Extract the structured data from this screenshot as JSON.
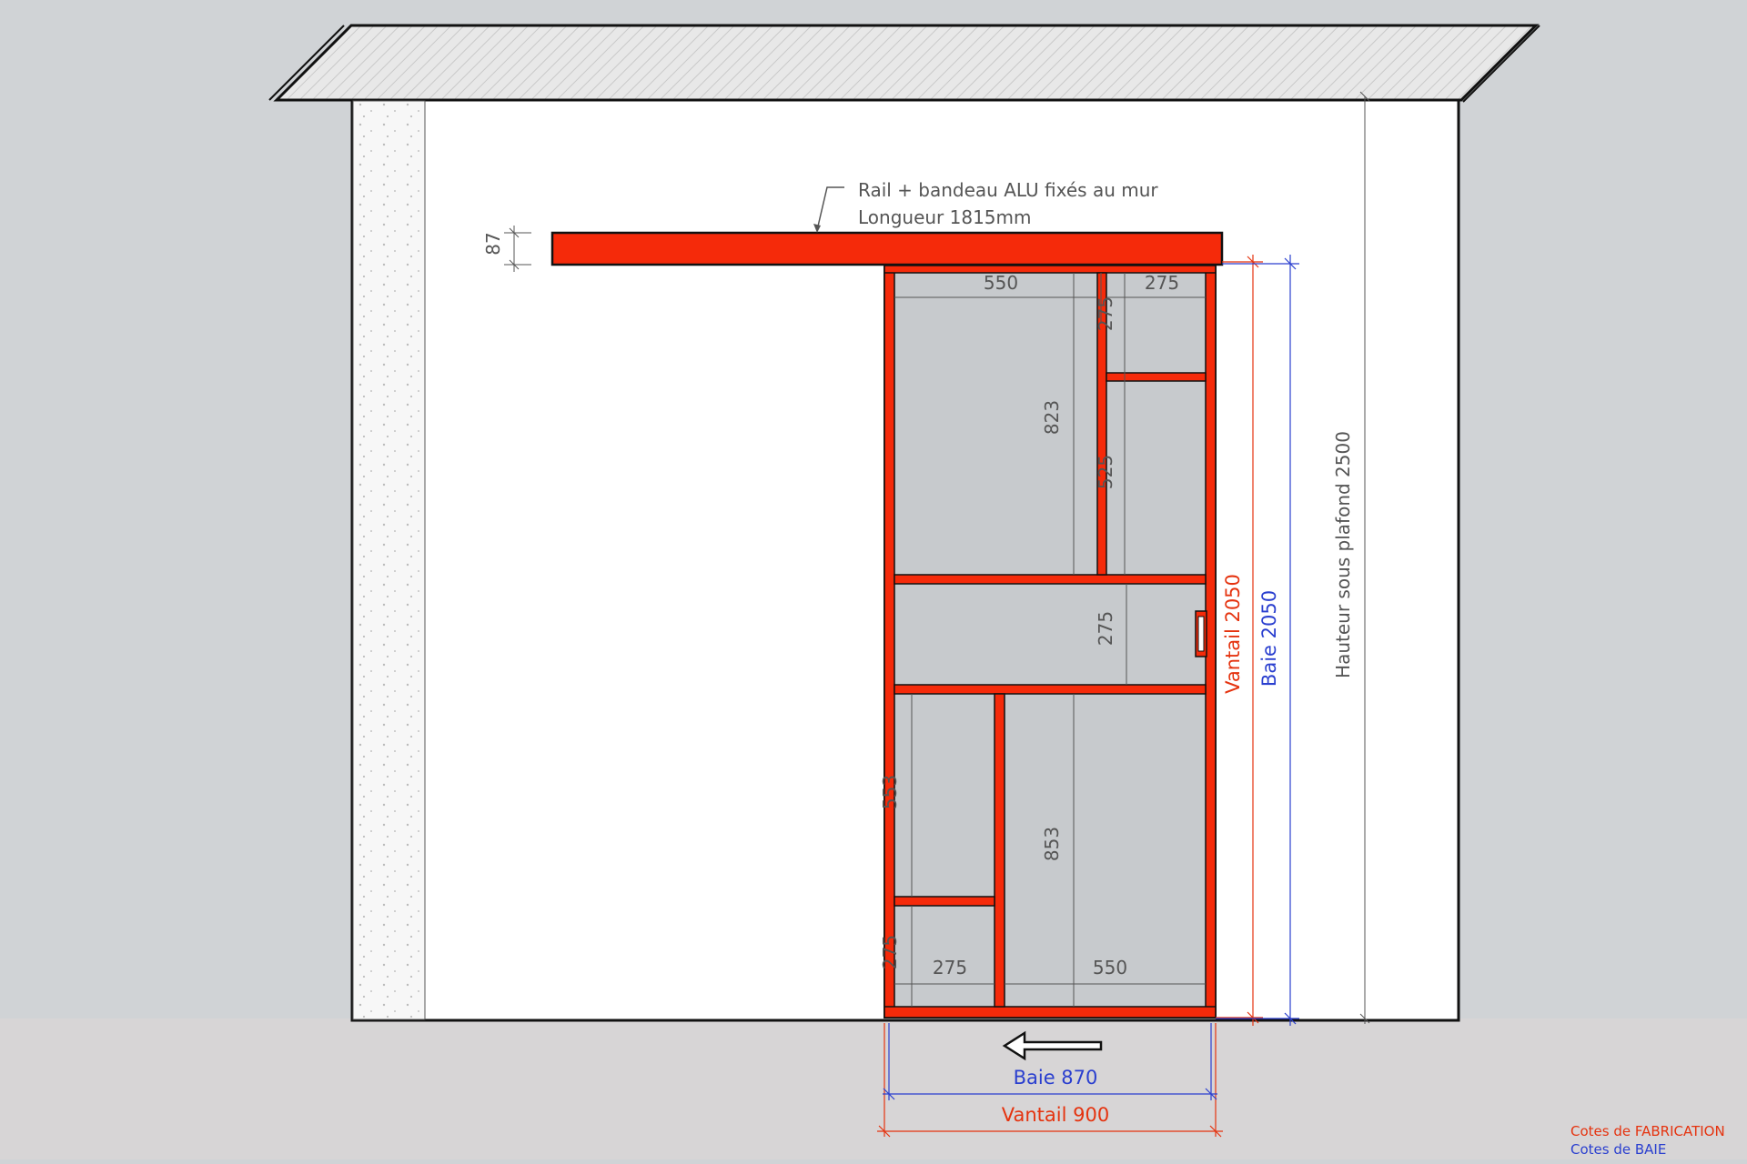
{
  "rail_note": {
    "line1": "Rail + bandeau ALU fixés au mur",
    "line2": "Longueur 1815mm"
  },
  "dimensions": {
    "rail_height": "87",
    "top_left_width": "550",
    "top_right_width": "275",
    "top_right_small_height": "275",
    "upper_left_height": "823",
    "upper_right_height": "525",
    "middle_band_height": "275",
    "lower_right_height": "853",
    "lower_left_height": "553",
    "bottom_small_height": "275",
    "bottom_left_width": "275",
    "bottom_right_width": "550",
    "vantail_height": "Vantail 2050",
    "baie_height": "Baie 2050",
    "ceiling_height": "Hauteur sous plafond 2500",
    "baie_width": "Baie 870",
    "vantail_width": "Vantail 900"
  },
  "legend": {
    "fabrication": "Cotes de FABRICATION",
    "baie": "Cotes de BAIE"
  },
  "colors": {
    "frame_red": "#f52a0a",
    "fabrication_red": "#e5330f",
    "baie_blue": "#2a3fcf",
    "panel_gray": "#c7cacd",
    "background": "#d0d3d6",
    "floor": "#d7d5d6"
  },
  "icons": {
    "slide_direction": "arrow-left-icon"
  }
}
